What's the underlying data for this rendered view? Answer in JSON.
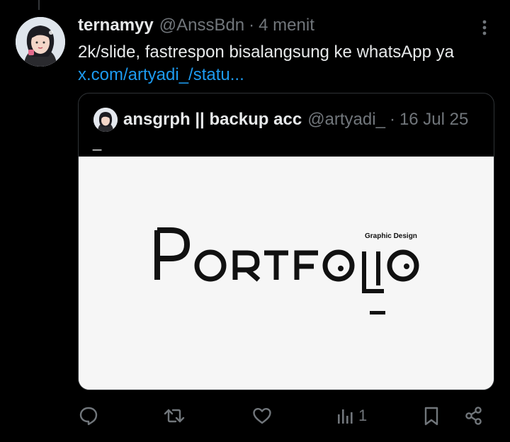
{
  "tweet": {
    "display_name": "ternamyy",
    "handle": "@AnssBdn",
    "separator": "·",
    "time": "4 menit",
    "text": "2k/slide, fastrespon bisalangsung ke whatsApp ya",
    "link": "x.com/artyadi_/statu..."
  },
  "quote": {
    "display_name": "ansgrph || backup acc",
    "handle": "@artyadi_",
    "separator": "·",
    "date": "16 Jul 25",
    "text": "_",
    "media": {
      "title": "PORTFOLIO",
      "subtitle": "Graphic Design",
      "background": "#f6f6f6"
    }
  },
  "actions": {
    "views_count": "1"
  },
  "colors": {
    "background": "#000000",
    "text": "#e7e9ea",
    "muted": "#71767b",
    "link": "#1d9bf0",
    "border": "#2f3336"
  },
  "icons": [
    "avatar",
    "more-icon",
    "reply-icon",
    "retweet-icon",
    "like-icon",
    "views-icon",
    "bookmark-icon",
    "share-icon"
  ]
}
